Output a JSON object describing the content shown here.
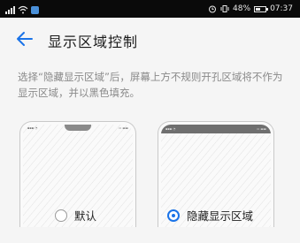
{
  "status_bar": {
    "battery_text": "48%",
    "time": "07:37"
  },
  "app_bar": {
    "title": "显示区域控制"
  },
  "description": "选择“隐藏显示区域”后，屏幕上方不规则开孔区域将不作为显示区域，并以黑色填充。",
  "options": [
    {
      "label": "默认",
      "selected": false
    },
    {
      "label": "隐藏显示区域",
      "selected": true
    }
  ],
  "colors": {
    "accent": "#1a73e8",
    "status_bar_bg": "#0a0a0a",
    "page_bg": "#f5f5f5"
  }
}
